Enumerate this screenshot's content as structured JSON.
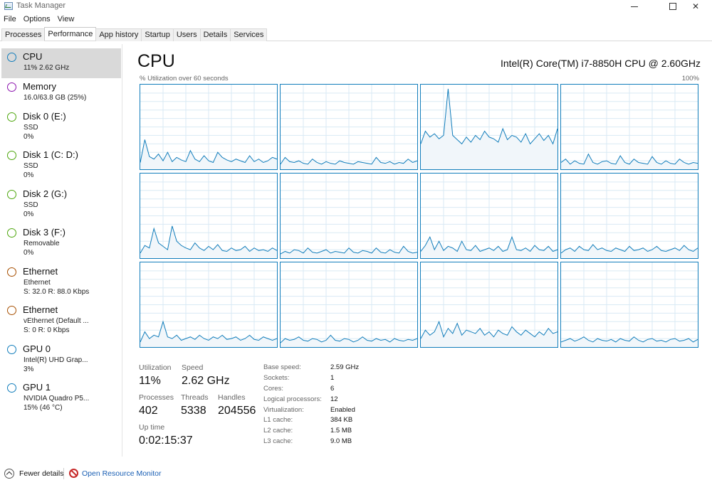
{
  "window": {
    "title": "Task Manager",
    "minimize_glyph": "—",
    "close_glyph": "✕"
  },
  "menu": [
    "File",
    "Options",
    "View"
  ],
  "tabs": [
    {
      "label": "Processes",
      "active": false
    },
    {
      "label": "Performance",
      "active": true
    },
    {
      "label": "App history",
      "active": false
    },
    {
      "label": "Startup",
      "active": false
    },
    {
      "label": "Users",
      "active": false
    },
    {
      "label": "Details",
      "active": false
    },
    {
      "label": "Services",
      "active": false
    }
  ],
  "sidebar": {
    "items": [
      {
        "title": "CPU",
        "line1": "11%  2.62 GHz",
        "line2": "",
        "color": "#117dbb",
        "selected": true
      },
      {
        "title": "Memory",
        "line1": "16.0/63.8 GB (25%)",
        "line2": "",
        "color": "#8b12ae",
        "selected": false
      },
      {
        "title": "Disk 0 (E:)",
        "line1": "SSD",
        "line2": "0%",
        "color": "#4da60c",
        "selected": false
      },
      {
        "title": "Disk 1 (C: D:)",
        "line1": "SSD",
        "line2": "0%",
        "color": "#4da60c",
        "selected": false
      },
      {
        "title": "Disk 2 (G:)",
        "line1": "SSD",
        "line2": "0%",
        "color": "#4da60c",
        "selected": false
      },
      {
        "title": "Disk 3 (F:)",
        "line1": "Removable",
        "line2": "0%",
        "color": "#4da60c",
        "selected": false
      },
      {
        "title": "Ethernet",
        "line1": "Ethernet",
        "line2": "S: 32.0  R: 88.0 Kbps",
        "color": "#a74f01",
        "selected": false
      },
      {
        "title": "Ethernet",
        "line1": "vEthernet (Default ...",
        "line2": "S: 0  R: 0 Kbps",
        "color": "#a74f01",
        "selected": false
      },
      {
        "title": "GPU 0",
        "line1": "Intel(R) UHD Grap...",
        "line2": "3%",
        "color": "#117dbb",
        "selected": false
      },
      {
        "title": "GPU 1",
        "line1": "NVIDIA Quadro P5...",
        "line2": "15%  (46 °C)",
        "color": "#117dbb",
        "selected": false
      }
    ]
  },
  "main": {
    "title": "CPU",
    "cpu_name": "Intel(R) Core(TM) i7-8850H CPU @ 2.60GHz",
    "graph_caption": "% Utilization over 60 seconds",
    "graph_max": "100%",
    "line_color": "#117dbb",
    "fill_color": "#f1f6fa",
    "grid_color": "#d9eaf4"
  },
  "stats": {
    "utilization_label": "Utilization",
    "utilization_value": "11%",
    "speed_label": "Speed",
    "speed_value": "2.62 GHz",
    "processes_label": "Processes",
    "processes_value": "402",
    "threads_label": "Threads",
    "threads_value": "5338",
    "handles_label": "Handles",
    "handles_value": "204556",
    "uptime_label": "Up time",
    "uptime_value": "0:02:15:37"
  },
  "specs": [
    {
      "key": "Base speed:",
      "value": "2.59 GHz"
    },
    {
      "key": "Sockets:",
      "value": "1"
    },
    {
      "key": "Cores:",
      "value": "6"
    },
    {
      "key": "Logical processors:",
      "value": "12"
    },
    {
      "key": "Virtualization:",
      "value": "Enabled"
    },
    {
      "key": "L1 cache:",
      "value": "384 KB"
    },
    {
      "key": "L2 cache:",
      "value": "1.5 MB"
    },
    {
      "key": "L3 cache:",
      "value": "9.0 MB"
    }
  ],
  "footer": {
    "fewer_details": "Fewer details",
    "resource_monitor": "Open Resource Monitor"
  },
  "chart_data": {
    "type": "area",
    "title": "% Utilization over 60 seconds",
    "ylim": [
      0,
      100
    ],
    "x": [
      0,
      2,
      4,
      6,
      8,
      10,
      12,
      14,
      16,
      18,
      20,
      22,
      24,
      26,
      28,
      30,
      32,
      34,
      36,
      38,
      40,
      42,
      44,
      46,
      48,
      50,
      52,
      54,
      56,
      58,
      60
    ],
    "series": [
      {
        "values": [
          8,
          35,
          15,
          12,
          18,
          10,
          20,
          9,
          14,
          11,
          9,
          22,
          12,
          9,
          16,
          10,
          8,
          20,
          14,
          11,
          9,
          12,
          10,
          8,
          16,
          9,
          12,
          8,
          10,
          14,
          12
        ]
      },
      {
        "values": [
          6,
          14,
          9,
          8,
          10,
          7,
          6,
          12,
          8,
          6,
          9,
          7,
          6,
          10,
          8,
          7,
          6,
          9,
          8,
          7,
          6,
          14,
          8,
          7,
          9,
          6,
          8,
          7,
          12,
          8,
          10
        ]
      },
      {
        "values": [
          30,
          45,
          38,
          42,
          36,
          40,
          95,
          40,
          35,
          30,
          38,
          32,
          40,
          35,
          45,
          38,
          36,
          32,
          48,
          35,
          40,
          38,
          32,
          42,
          30,
          36,
          42,
          34,
          40,
          30,
          48
        ]
      },
      {
        "values": [
          8,
          12,
          6,
          10,
          7,
          6,
          18,
          8,
          6,
          9,
          10,
          7,
          6,
          16,
          8,
          6,
          12,
          8,
          7,
          6,
          15,
          8,
          6,
          10,
          7,
          6,
          12,
          8,
          6,
          8,
          7
        ]
      },
      {
        "values": [
          6,
          15,
          12,
          35,
          18,
          14,
          10,
          38,
          20,
          15,
          12,
          10,
          18,
          12,
          9,
          14,
          10,
          16,
          9,
          8,
          12,
          9,
          10,
          14,
          8,
          12,
          9,
          10,
          8,
          12,
          9
        ]
      },
      {
        "values": [
          5,
          8,
          6,
          10,
          9,
          6,
          12,
          7,
          6,
          8,
          10,
          6,
          8,
          7,
          6,
          12,
          7,
          6,
          9,
          8,
          6,
          12,
          7,
          6,
          10,
          7,
          6,
          14,
          8,
          6,
          7
        ]
      },
      {
        "values": [
          8,
          15,
          25,
          10,
          20,
          9,
          14,
          12,
          8,
          20,
          10,
          9,
          15,
          8,
          10,
          12,
          9,
          14,
          8,
          10,
          25,
          10,
          9,
          12,
          8,
          15,
          10,
          9,
          14,
          8,
          10
        ]
      },
      {
        "values": [
          6,
          10,
          12,
          8,
          14,
          10,
          9,
          16,
          10,
          12,
          9,
          8,
          12,
          10,
          8,
          14,
          9,
          10,
          12,
          8,
          10,
          14,
          9,
          8,
          10,
          12,
          9,
          15,
          10,
          8,
          12
        ]
      },
      {
        "values": [
          6,
          18,
          10,
          14,
          12,
          30,
          12,
          10,
          14,
          8,
          10,
          12,
          9,
          14,
          10,
          8,
          12,
          10,
          14,
          9,
          10,
          12,
          8,
          10,
          14,
          9,
          8,
          12,
          10,
          8,
          10
        ]
      },
      {
        "values": [
          5,
          10,
          8,
          9,
          12,
          8,
          7,
          10,
          9,
          6,
          8,
          14,
          8,
          7,
          10,
          9,
          6,
          8,
          12,
          8,
          7,
          10,
          8,
          9,
          6,
          10,
          8,
          7,
          9,
          8,
          10
        ]
      },
      {
        "values": [
          10,
          20,
          14,
          18,
          30,
          12,
          22,
          16,
          28,
          14,
          20,
          18,
          16,
          22,
          14,
          18,
          12,
          20,
          16,
          14,
          24,
          18,
          14,
          20,
          16,
          12,
          18,
          14,
          22,
          16,
          18
        ]
      },
      {
        "values": [
          6,
          8,
          10,
          7,
          9,
          12,
          8,
          6,
          10,
          8,
          7,
          9,
          6,
          10,
          8,
          7,
          12,
          8,
          6,
          9,
          10,
          7,
          8,
          6,
          9,
          10,
          7,
          8,
          10,
          6,
          9
        ]
      }
    ]
  }
}
